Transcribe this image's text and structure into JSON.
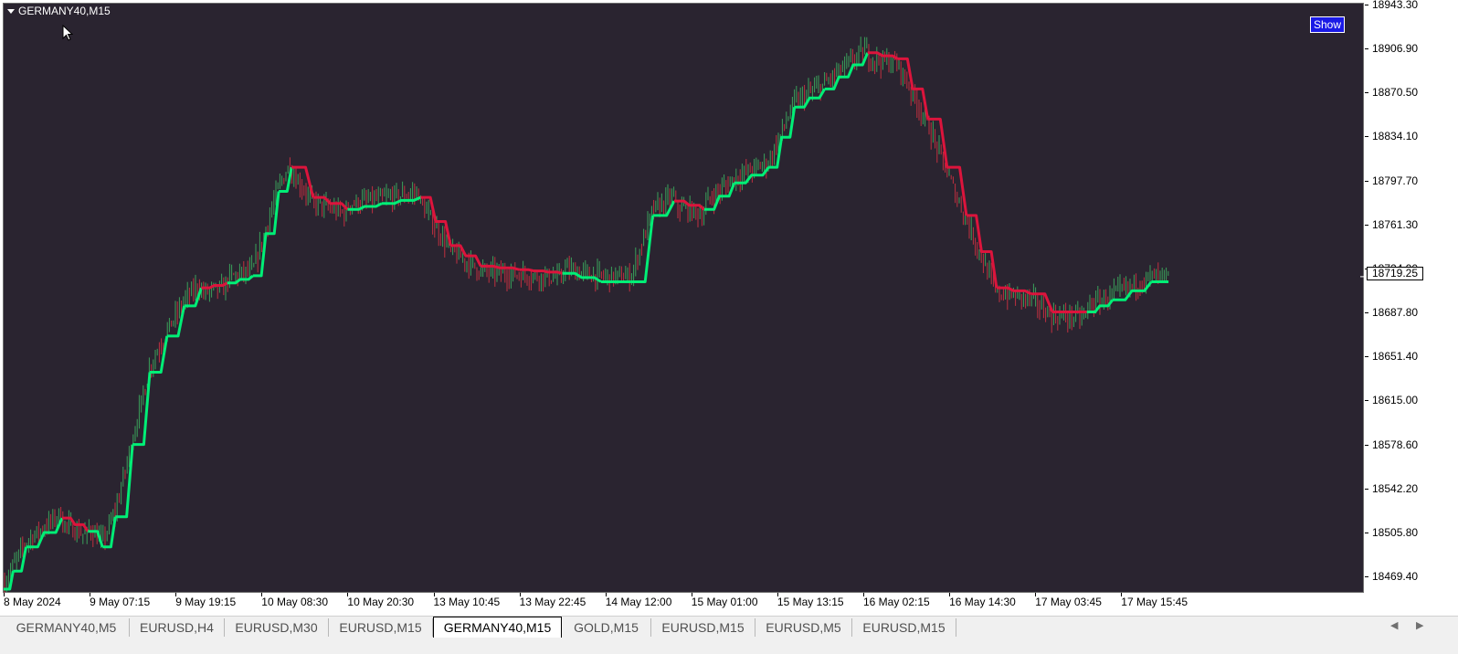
{
  "window": {
    "symbol_title": "GERMANY40,M15",
    "show_button_label": "Show",
    "current_price": "18719.25"
  },
  "price_axis": {
    "labels": [
      "18943.30",
      "18906.90",
      "18870.50",
      "18834.10",
      "18797.70",
      "18761.30",
      "18724.90",
      "18687.80",
      "18651.40",
      "18615.00",
      "18578.60",
      "18542.20",
      "18505.80",
      "18469.40"
    ]
  },
  "time_axis": {
    "labels": [
      "8 May 2024",
      "9 May 07:15",
      "9 May 19:15",
      "10 May 08:30",
      "10 May 20:30",
      "13 May 10:45",
      "13 May 22:45",
      "14 May 12:00",
      "15 May 01:00",
      "15 May 13:15",
      "16 May 02:15",
      "16 May 14:30",
      "17 May 03:45",
      "17 May 15:45"
    ]
  },
  "tabs": [
    {
      "label": "GERMANY40,M5",
      "active": false
    },
    {
      "label": "EURUSD,H4",
      "active": false
    },
    {
      "label": "EURUSD,M30",
      "active": false
    },
    {
      "label": "EURUSD,M15",
      "active": false
    },
    {
      "label": "GERMANY40,M15",
      "active": true
    },
    {
      "label": "GOLD,M15",
      "active": false
    },
    {
      "label": "EURUSD,M15",
      "active": false
    },
    {
      "label": "EURUSD,M5",
      "active": false
    },
    {
      "label": "EURUSD,M15",
      "active": false
    }
  ],
  "icons": {
    "scroll_left": "scroll-left-icon",
    "scroll_right": "scroll-right-icon",
    "collapse": "triangle-down-icon",
    "cursor": "mouse-pointer-icon"
  },
  "colors": {
    "background": "#2a2430",
    "trend_up": "#00ee76",
    "trend_down": "#dc143c",
    "candle_up": "#3aa05a",
    "candle_down": "#c03040",
    "show_button": "#1a1ae6"
  },
  "chart_data": {
    "type": "line",
    "title": "",
    "ylim": [
      18460,
      18945
    ],
    "x": [
      "8 May 2024",
      "9 May 07:15",
      "9 May 19:15",
      "10 May 08:30",
      "10 May 20:30",
      "13 May 10:45",
      "13 May 22:45",
      "14 May 12:00",
      "15 May 01:00",
      "15 May 13:15",
      "16 May 02:15",
      "16 May 14:30",
      "17 May 03:45",
      "17 May 15:45"
    ],
    "series": [
      {
        "points": [
          [
            0,
            18460,
            "up"
          ],
          [
            0.11,
            18475,
            "up"
          ],
          [
            0.26,
            18495,
            "up"
          ],
          [
            0.68,
            18519,
            "up"
          ],
          [
            0.98,
            18508,
            "down"
          ],
          [
            1.15,
            18495,
            "up"
          ],
          [
            1.3,
            18520,
            "up"
          ],
          [
            1.5,
            18580,
            "up"
          ],
          [
            1.7,
            18640,
            "up"
          ],
          [
            1.9,
            18670,
            "up"
          ],
          [
            2.1,
            18695,
            "up"
          ],
          [
            2.3,
            18710,
            "up"
          ],
          [
            2.6,
            18714,
            "down"
          ],
          [
            2.9,
            18720,
            "up"
          ],
          [
            3.2,
            18790,
            "up"
          ],
          [
            3.35,
            18810,
            "up"
          ],
          [
            3.6,
            18785,
            "down"
          ],
          [
            4.0,
            18775,
            "down"
          ],
          [
            4.4,
            18780,
            "up"
          ],
          [
            4.85,
            18785,
            "up"
          ],
          [
            5.2,
            18745,
            "down"
          ],
          [
            5.55,
            18728,
            "down"
          ],
          [
            6.0,
            18725,
            "down"
          ],
          [
            6.5,
            18722,
            "down"
          ],
          [
            6.95,
            18715,
            "up"
          ],
          [
            7.3,
            18715,
            "up"
          ],
          [
            7.55,
            18770,
            "up"
          ],
          [
            7.8,
            18782,
            "up"
          ],
          [
            8.15,
            18775,
            "down"
          ],
          [
            8.5,
            18797,
            "up"
          ],
          [
            8.9,
            18810,
            "up"
          ],
          [
            9.2,
            18860,
            "up"
          ],
          [
            9.55,
            18875,
            "up"
          ],
          [
            10.05,
            18905,
            "up"
          ],
          [
            10.4,
            18900,
            "down"
          ],
          [
            10.75,
            18850,
            "down"
          ],
          [
            11.2,
            18770,
            "down"
          ],
          [
            11.55,
            18710,
            "down"
          ],
          [
            11.95,
            18705,
            "down"
          ],
          [
            12.2,
            18690,
            "down"
          ],
          [
            12.6,
            18690,
            "down"
          ],
          [
            12.9,
            18700,
            "up"
          ],
          [
            13.35,
            18715,
            "up"
          ],
          [
            13.55,
            18715,
            "up"
          ]
        ]
      }
    ]
  }
}
